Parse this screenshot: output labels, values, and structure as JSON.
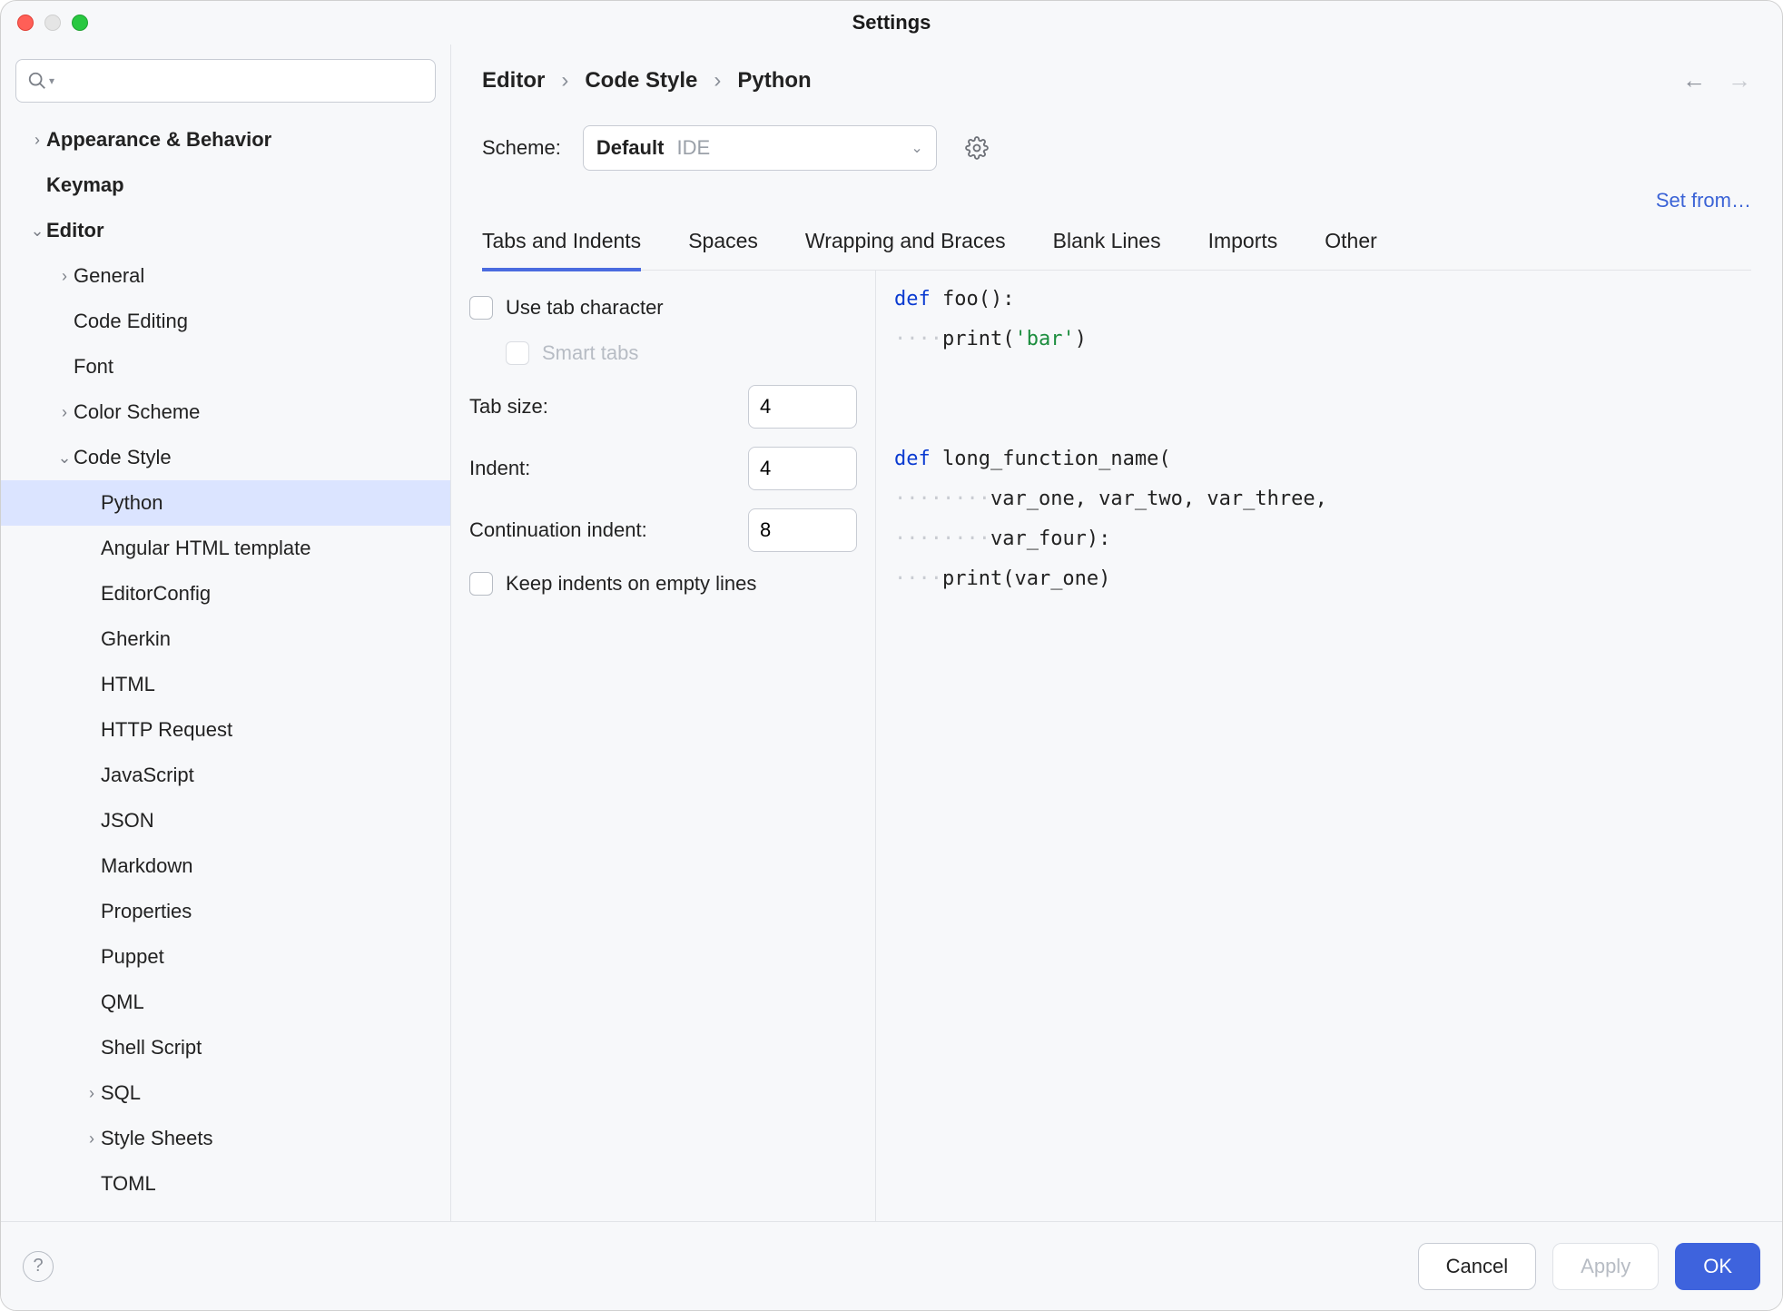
{
  "window": {
    "title": "Settings"
  },
  "sidebar": {
    "search_placeholder": "",
    "items": [
      {
        "label": "Appearance & Behavior",
        "chev": "›",
        "bold": true,
        "pad": 30
      },
      {
        "label": "Keymap",
        "chev": "",
        "bold": true,
        "pad": 30
      },
      {
        "label": "Editor",
        "chev": "⌄",
        "bold": true,
        "pad": 30
      },
      {
        "label": "General",
        "chev": "›",
        "bold": false,
        "pad": 60
      },
      {
        "label": "Code Editing",
        "chev": "",
        "bold": false,
        "pad": 60
      },
      {
        "label": "Font",
        "chev": "",
        "bold": false,
        "pad": 60
      },
      {
        "label": "Color Scheme",
        "chev": "›",
        "bold": false,
        "pad": 60
      },
      {
        "label": "Code Style",
        "chev": "⌄",
        "bold": false,
        "pad": 60
      },
      {
        "label": "Python",
        "chev": "",
        "bold": false,
        "pad": 90,
        "selected": true
      },
      {
        "label": "Angular HTML template",
        "chev": "",
        "bold": false,
        "pad": 90
      },
      {
        "label": "EditorConfig",
        "chev": "",
        "bold": false,
        "pad": 90
      },
      {
        "label": "Gherkin",
        "chev": "",
        "bold": false,
        "pad": 90
      },
      {
        "label": "HTML",
        "chev": "",
        "bold": false,
        "pad": 90
      },
      {
        "label": "HTTP Request",
        "chev": "",
        "bold": false,
        "pad": 90
      },
      {
        "label": "JavaScript",
        "chev": "",
        "bold": false,
        "pad": 90
      },
      {
        "label": "JSON",
        "chev": "",
        "bold": false,
        "pad": 90
      },
      {
        "label": "Markdown",
        "chev": "",
        "bold": false,
        "pad": 90
      },
      {
        "label": "Properties",
        "chev": "",
        "bold": false,
        "pad": 90
      },
      {
        "label": "Puppet",
        "chev": "",
        "bold": false,
        "pad": 90
      },
      {
        "label": "QML",
        "chev": "",
        "bold": false,
        "pad": 90
      },
      {
        "label": "Shell Script",
        "chev": "",
        "bold": false,
        "pad": 90
      },
      {
        "label": "SQL",
        "chev": "›",
        "bold": false,
        "pad": 90
      },
      {
        "label": "Style Sheets",
        "chev": "›",
        "bold": false,
        "pad": 90
      },
      {
        "label": "TOML",
        "chev": "",
        "bold": false,
        "pad": 90
      }
    ]
  },
  "breadcrumb": {
    "a": "Editor",
    "b": "Code Style",
    "c": "Python",
    "sep": "›"
  },
  "scheme": {
    "label": "Scheme:",
    "name": "Default",
    "scope": "IDE"
  },
  "setfrom": "Set from…",
  "tabs": [
    "Tabs and Indents",
    "Spaces",
    "Wrapping and Braces",
    "Blank Lines",
    "Imports",
    "Other"
  ],
  "form": {
    "use_tab": "Use tab character",
    "smart_tabs": "Smart tabs",
    "tab_size_label": "Tab size:",
    "tab_size_value": "4",
    "indent_label": "Indent:",
    "indent_value": "4",
    "cont_label": "Continuation indent:",
    "cont_value": "8",
    "keep_indents": "Keep indents on empty lines"
  },
  "preview": {
    "l1_kw": "def",
    "l1_rest": " foo():",
    "l2_ws": "····",
    "l2_rest_a": "print(",
    "l2_str": "'bar'",
    "l2_rest_b": ")",
    "l3_kw": "def",
    "l3_rest": " long_function_name(",
    "l4_ws": "········",
    "l4_rest": "var_one, var_two, var_three,",
    "l5_ws": "········",
    "l5_rest": "var_four):",
    "l6_ws": "····",
    "l6_rest": "print(var_one)"
  },
  "footer": {
    "cancel": "Cancel",
    "apply": "Apply",
    "ok": "OK"
  }
}
